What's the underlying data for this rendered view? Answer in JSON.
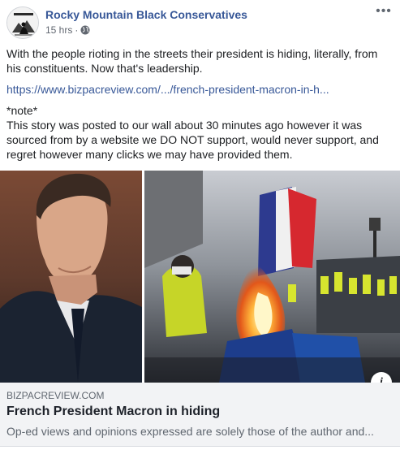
{
  "post": {
    "page_name": "Rocky Mountain Black Conservatives",
    "time": "15 hrs",
    "separator": "·",
    "privacy_icon": "globe-icon",
    "more_icon": "ellipsis-icon",
    "more_label": "•••",
    "body_text": "With the people rioting in the streets their president is hiding, literally, from his constituents. Now that's leadership.",
    "link_text": "https://www.bizpacreview.com/.../french-president-macron-in-h...",
    "note_label": "*note*",
    "note_text": "This story was posted to our wall about 30 minutes ago however it was sourced from by a website we DO NOT support, would never support, and regret however many clicks we may have provided them."
  },
  "link_preview": {
    "info_icon": "info-icon",
    "info_label": "i",
    "domain": "BIZPACREVIEW.COM",
    "headline": "French President Macron in hiding",
    "description": "Op-ed views and opinions expressed are solely those of the author and..."
  },
  "colors": {
    "link_blue": "#385898",
    "preview_bg": "#f2f3f5",
    "text": "#1c1e21",
    "muted": "#606770"
  }
}
